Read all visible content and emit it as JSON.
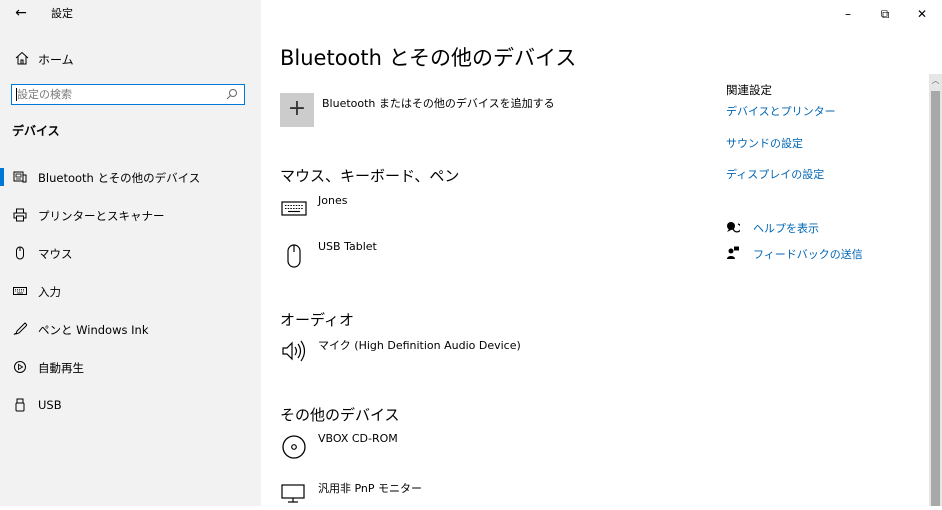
{
  "window": {
    "app_title": "設定",
    "back_glyph": "←",
    "minimize_glyph": "–",
    "restore_glyph": "⧉",
    "close_glyph": "✕"
  },
  "sidebar": {
    "home_label": "ホーム",
    "search_placeholder": "設定の検索",
    "section_title": "デバイス",
    "items": [
      {
        "label": "Bluetooth とその他のデバイス",
        "icon": "bluetooth-devices-icon",
        "selected": true
      },
      {
        "label": "プリンターとスキャナー",
        "icon": "printer-icon"
      },
      {
        "label": "マウス",
        "icon": "mouse-icon"
      },
      {
        "label": "入力",
        "icon": "keyboard-icon"
      },
      {
        "label": "ペンと Windows Ink",
        "icon": "pen-icon"
      },
      {
        "label": "自動再生",
        "icon": "autoplay-icon"
      },
      {
        "label": "USB",
        "icon": "usb-icon"
      }
    ]
  },
  "main": {
    "title": "Bluetooth とその他のデバイス",
    "add_device_label": "Bluetooth またはその他のデバイスを追加する",
    "groups": [
      {
        "title": "マウス、キーボード、ペン",
        "devices": [
          {
            "name": "Jones",
            "icon": "keyboard-icon"
          },
          {
            "name": "USB Tablet",
            "icon": "mouse-icon"
          }
        ]
      },
      {
        "title": "オーディオ",
        "devices": [
          {
            "name": "マイク (High Definition Audio Device)",
            "icon": "speaker-icon"
          }
        ]
      },
      {
        "title": "その他のデバイス",
        "devices": [
          {
            "name": "VBOX CD-ROM",
            "icon": "disc-icon"
          },
          {
            "name": "汎用非 PnP モニター",
            "icon": "monitor-icon"
          }
        ]
      }
    ]
  },
  "related": {
    "title": "関連設定",
    "links": [
      "デバイスとプリンター",
      "サウンドの設定",
      "ディスプレイの設定"
    ],
    "help_label": "ヘルプを表示",
    "feedback_label": "フィードバックの送信"
  },
  "colors": {
    "accent": "#0078d7",
    "link": "#0066b4",
    "sidebar_bg": "#f2f2f2"
  }
}
